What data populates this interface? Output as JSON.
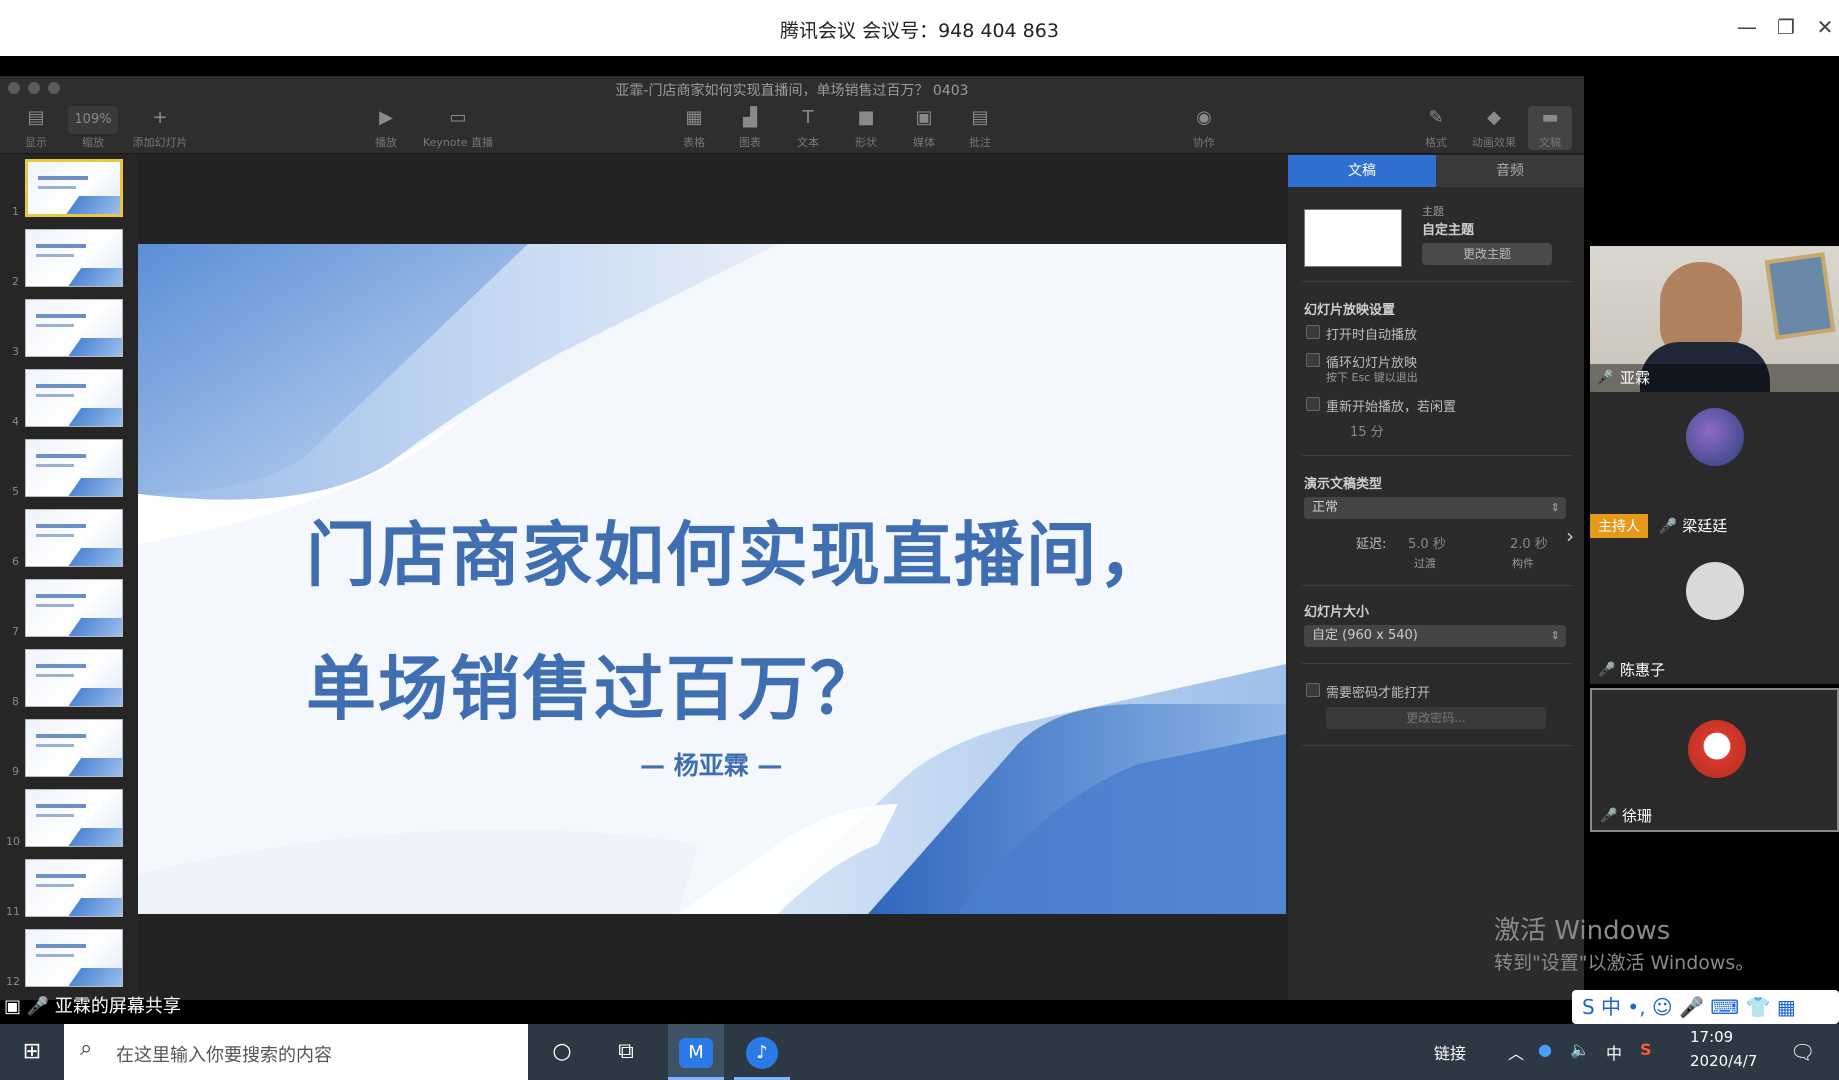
{
  "meeting": {
    "title": "腾讯会议 会议号：948 404 863",
    "minimize": "—",
    "restore": "❐",
    "close": "✕"
  },
  "keynote": {
    "doc_title": "亚霏-门店商家如何实现直播间，单场销售过百万？ 0403",
    "toolbar": {
      "view": "显示",
      "zoom_value": "109%",
      "zoom": "缩放",
      "add_slide": "添加幻灯片",
      "play": "播放",
      "keynote_live": "Keynote 直播",
      "table": "表格",
      "chart": "图表",
      "text": "文本",
      "shape": "形状",
      "media": "媒体",
      "comment": "批注",
      "collaborate": "协作",
      "format": "格式",
      "animate": "动画效果",
      "document": "文稿"
    },
    "slide_numbers": [
      "1",
      "2",
      "3",
      "4",
      "5",
      "6",
      "7",
      "8",
      "9",
      "10",
      "11",
      "12"
    ],
    "slide": {
      "title_line1": "门店商家如何实现直播间，",
      "title_line2": "单场销售过百万？",
      "author": "— 杨亚霖 —"
    },
    "inspector": {
      "tab_document": "文稿",
      "tab_audio": "音频",
      "theme_label": "主题",
      "theme_name": "自定主题",
      "change_theme": "更改主题",
      "slideshow_settings": "幻灯片放映设置",
      "autoplay": "打开时自动播放",
      "loop": "循环幻灯片放映",
      "loop_hint": "按下 Esc 键以退出",
      "restart_idle": "重新开始播放，若闲置",
      "idle_minutes": "15 分",
      "presentation_type": "演示文稿类型",
      "presentation_type_value": "正常",
      "delay": "延迟:",
      "transition_value": "5.0 秒",
      "transition_label": "过渡",
      "build_value": "2.0 秒",
      "build_label": "构件",
      "slide_size": "幻灯片大小",
      "slide_size_value": "自定 (960 x 540)",
      "require_password": "需要密码才能打开",
      "change_password": "更改密码..."
    }
  },
  "participants": [
    {
      "name": "亚霖"
    },
    {
      "name": "梁廷廷",
      "badge": "主持人"
    },
    {
      "name": "陈惠子"
    },
    {
      "name": "徐珊"
    }
  ],
  "share_label": "亚霖的屏幕共享",
  "activation": {
    "line1": "激活 Windows",
    "line2": "转到\"设置\"以激活 Windows。"
  },
  "ime": {
    "text": "S 中 •, ☺ 🎤 ⌨ 👕 ▦"
  },
  "taskbar": {
    "search_placeholder": "在这里输入你要搜索的内容",
    "link": "链接",
    "tray_lang": "中",
    "time": "17:09",
    "date": "2020/4/7"
  },
  "colors": {
    "accent": "#2f6fd0",
    "slide_title": "#3f6fb1",
    "host_badge": "#e69a1c"
  }
}
